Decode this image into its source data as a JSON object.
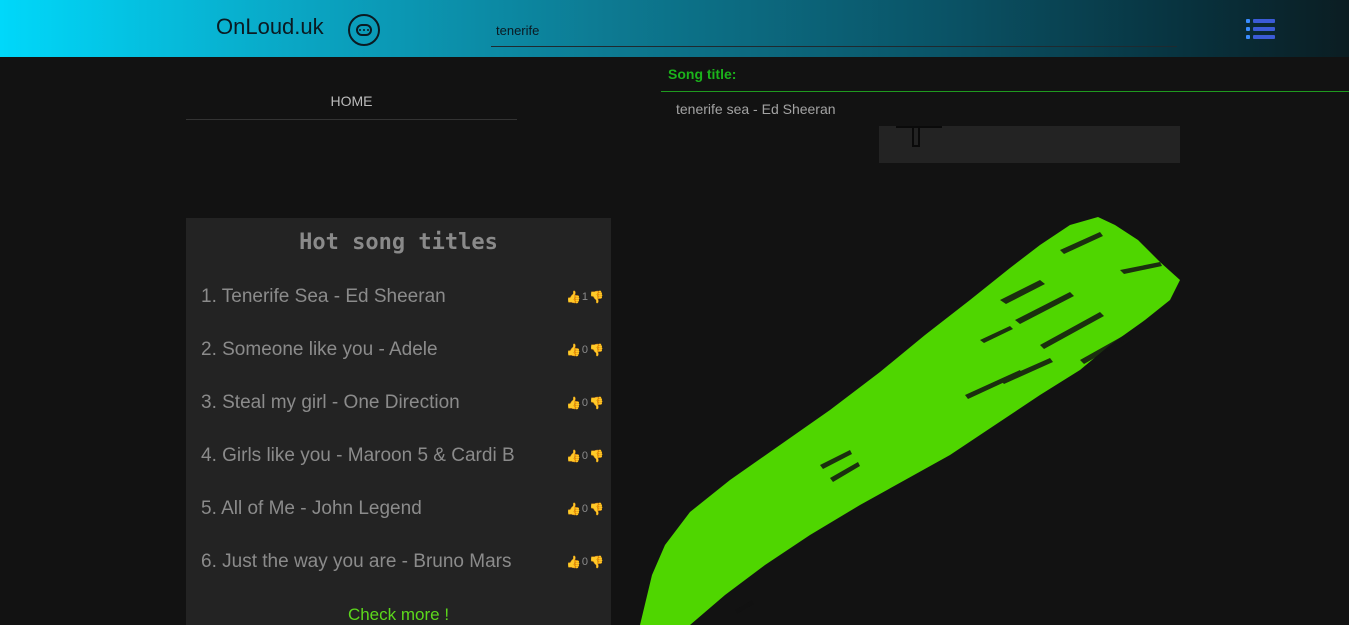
{
  "header": {
    "logo": "OnLoud.uk",
    "search_value": "tenerife"
  },
  "nav": {
    "home": "HOME"
  },
  "hot_songs": {
    "title": "Hot song titles",
    "items": [
      {
        "label": "1. Tenerife Sea - Ed Sheeran",
        "votes": "1"
      },
      {
        "label": "2. Someone like you - Adele",
        "votes": "0"
      },
      {
        "label": "3. Steal my girl - One Direction",
        "votes": "0"
      },
      {
        "label": "4. Girls like you - Maroon 5 & Cardi B",
        "votes": "0"
      },
      {
        "label": "5. All of Me - John Legend",
        "votes": "0"
      },
      {
        "label": "6. Just the way you are - Bruno Mars",
        "votes": "0"
      }
    ],
    "check_more": "Check more !"
  },
  "results": {
    "label": "Song title:",
    "items": [
      "tenerife sea - Ed Sheeran"
    ]
  },
  "colors": {
    "accent_green": "#5cd81c",
    "title_green": "#1bb31b",
    "brush_green": "#4fd600"
  },
  "icons": {
    "chat": "chat-bubble-icon",
    "menu": "list-menu-icon",
    "thumb_up": "thumbs-up-icon",
    "thumb_down": "thumbs-down-icon"
  }
}
